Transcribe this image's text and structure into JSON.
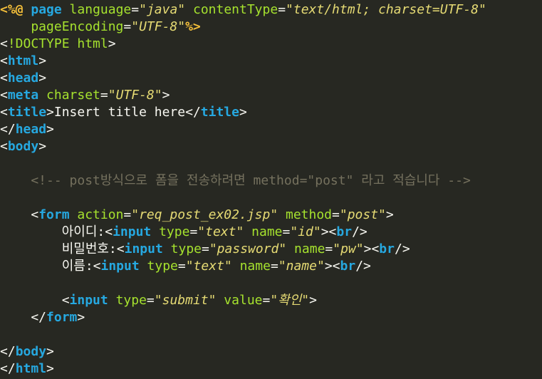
{
  "editor": {
    "lines": [
      [
        {
          "t": "<%@",
          "c": "dir"
        },
        {
          "t": " ",
          "c": "text"
        },
        {
          "t": "page",
          "c": "tag"
        },
        {
          "t": " language",
          "c": "attr"
        },
        {
          "t": "=",
          "c": "punc"
        },
        {
          "t": "\"java\"",
          "c": "val"
        },
        {
          "t": " contentType",
          "c": "attr"
        },
        {
          "t": "=",
          "c": "punc"
        },
        {
          "t": "\"text/html; charset=UTF-8\"",
          "c": "val"
        }
      ],
      [
        {
          "t": "    pageEncoding",
          "c": "attr"
        },
        {
          "t": "=",
          "c": "punc"
        },
        {
          "t": "\"UTF-8\"",
          "c": "val"
        },
        {
          "t": "%>",
          "c": "dir"
        }
      ],
      [
        {
          "t": "<",
          "c": "punc"
        },
        {
          "t": "!DOCTYPE",
          "c": "doctype"
        },
        {
          "t": " html",
          "c": "doctype"
        },
        {
          "t": ">",
          "c": "punc"
        }
      ],
      [
        {
          "t": "<",
          "c": "punc"
        },
        {
          "t": "html",
          "c": "tag"
        },
        {
          "t": ">",
          "c": "punc"
        }
      ],
      [
        {
          "t": "<",
          "c": "punc"
        },
        {
          "t": "head",
          "c": "tag"
        },
        {
          "t": ">",
          "c": "punc"
        }
      ],
      [
        {
          "t": "<",
          "c": "punc"
        },
        {
          "t": "meta",
          "c": "tag"
        },
        {
          "t": " charset",
          "c": "attr"
        },
        {
          "t": "=",
          "c": "punc"
        },
        {
          "t": "\"UTF-8\"",
          "c": "val"
        },
        {
          "t": ">",
          "c": "punc"
        }
      ],
      [
        {
          "t": "<",
          "c": "punc"
        },
        {
          "t": "title",
          "c": "tag"
        },
        {
          "t": ">",
          "c": "punc"
        },
        {
          "t": "Insert title here",
          "c": "text"
        },
        {
          "t": "</",
          "c": "punc"
        },
        {
          "t": "title",
          "c": "tag"
        },
        {
          "t": ">",
          "c": "punc"
        }
      ],
      [
        {
          "t": "</",
          "c": "punc"
        },
        {
          "t": "head",
          "c": "tag"
        },
        {
          "t": ">",
          "c": "punc"
        }
      ],
      [
        {
          "t": "<",
          "c": "punc"
        },
        {
          "t": "body",
          "c": "tag"
        },
        {
          "t": ">",
          "c": "punc"
        }
      ],
      [],
      [
        {
          "t": "    <!-- post방식으로 폼을 전송하려면 method=\"post\" 라고 적습니다 -->",
          "c": "comment"
        }
      ],
      [],
      [
        {
          "t": "    <",
          "c": "punc"
        },
        {
          "t": "form",
          "c": "tag"
        },
        {
          "t": " action",
          "c": "attr"
        },
        {
          "t": "=",
          "c": "punc"
        },
        {
          "t": "\"req_post_ex02.jsp\"",
          "c": "val"
        },
        {
          "t": " method",
          "c": "attr"
        },
        {
          "t": "=",
          "c": "punc"
        },
        {
          "t": "\"post\"",
          "c": "val"
        },
        {
          "t": ">",
          "c": "punc"
        }
      ],
      [
        {
          "t": "        아이디:",
          "c": "text"
        },
        {
          "t": "<",
          "c": "punc"
        },
        {
          "t": "input",
          "c": "tag"
        },
        {
          "t": " type",
          "c": "attr"
        },
        {
          "t": "=",
          "c": "punc"
        },
        {
          "t": "\"text\"",
          "c": "val"
        },
        {
          "t": " name",
          "c": "attr"
        },
        {
          "t": "=",
          "c": "punc"
        },
        {
          "t": "\"id\"",
          "c": "val"
        },
        {
          "t": "><",
          "c": "punc"
        },
        {
          "t": "br",
          "c": "tag"
        },
        {
          "t": "/>",
          "c": "punc"
        }
      ],
      [
        {
          "t": "        비밀번호:",
          "c": "text"
        },
        {
          "t": "<",
          "c": "punc"
        },
        {
          "t": "input",
          "c": "tag"
        },
        {
          "t": " type",
          "c": "attr"
        },
        {
          "t": "=",
          "c": "punc"
        },
        {
          "t": "\"password\"",
          "c": "val"
        },
        {
          "t": " name",
          "c": "attr"
        },
        {
          "t": "=",
          "c": "punc"
        },
        {
          "t": "\"pw\"",
          "c": "val"
        },
        {
          "t": "><",
          "c": "punc"
        },
        {
          "t": "br",
          "c": "tag"
        },
        {
          "t": "/>",
          "c": "punc"
        }
      ],
      [
        {
          "t": "        이름:",
          "c": "text"
        },
        {
          "t": "<",
          "c": "punc"
        },
        {
          "t": "input",
          "c": "tag"
        },
        {
          "t": " type",
          "c": "attr"
        },
        {
          "t": "=",
          "c": "punc"
        },
        {
          "t": "\"text\"",
          "c": "val"
        },
        {
          "t": " name",
          "c": "attr"
        },
        {
          "t": "=",
          "c": "punc"
        },
        {
          "t": "\"name\"",
          "c": "val"
        },
        {
          "t": "><",
          "c": "punc"
        },
        {
          "t": "br",
          "c": "tag"
        },
        {
          "t": "/>",
          "c": "punc"
        }
      ],
      [],
      [
        {
          "t": "        <",
          "c": "punc"
        },
        {
          "t": "input",
          "c": "tag"
        },
        {
          "t": " type",
          "c": "attr"
        },
        {
          "t": "=",
          "c": "punc"
        },
        {
          "t": "\"submit\"",
          "c": "val"
        },
        {
          "t": " value",
          "c": "attr"
        },
        {
          "t": "=",
          "c": "punc"
        },
        {
          "t": "\"확인\"",
          "c": "val"
        },
        {
          "t": ">",
          "c": "punc"
        }
      ],
      [
        {
          "t": "    </",
          "c": "punc"
        },
        {
          "t": "form",
          "c": "tag"
        },
        {
          "t": ">",
          "c": "punc"
        }
      ],
      [],
      [
        {
          "t": "</",
          "c": "punc"
        },
        {
          "t": "body",
          "c": "tag"
        },
        {
          "t": ">",
          "c": "punc"
        }
      ],
      [
        {
          "t": "</",
          "c": "punc"
        },
        {
          "t": "html",
          "c": "tag"
        },
        {
          "t": ">",
          "c": "punc"
        }
      ]
    ]
  },
  "colors": {
    "background": "#272822",
    "tag": "#26a8e0",
    "attribute": "#a6e22e",
    "value": "#e6db74",
    "directive": "#f4bf3a",
    "comment": "#75715e",
    "text": "#f8f8f2"
  }
}
